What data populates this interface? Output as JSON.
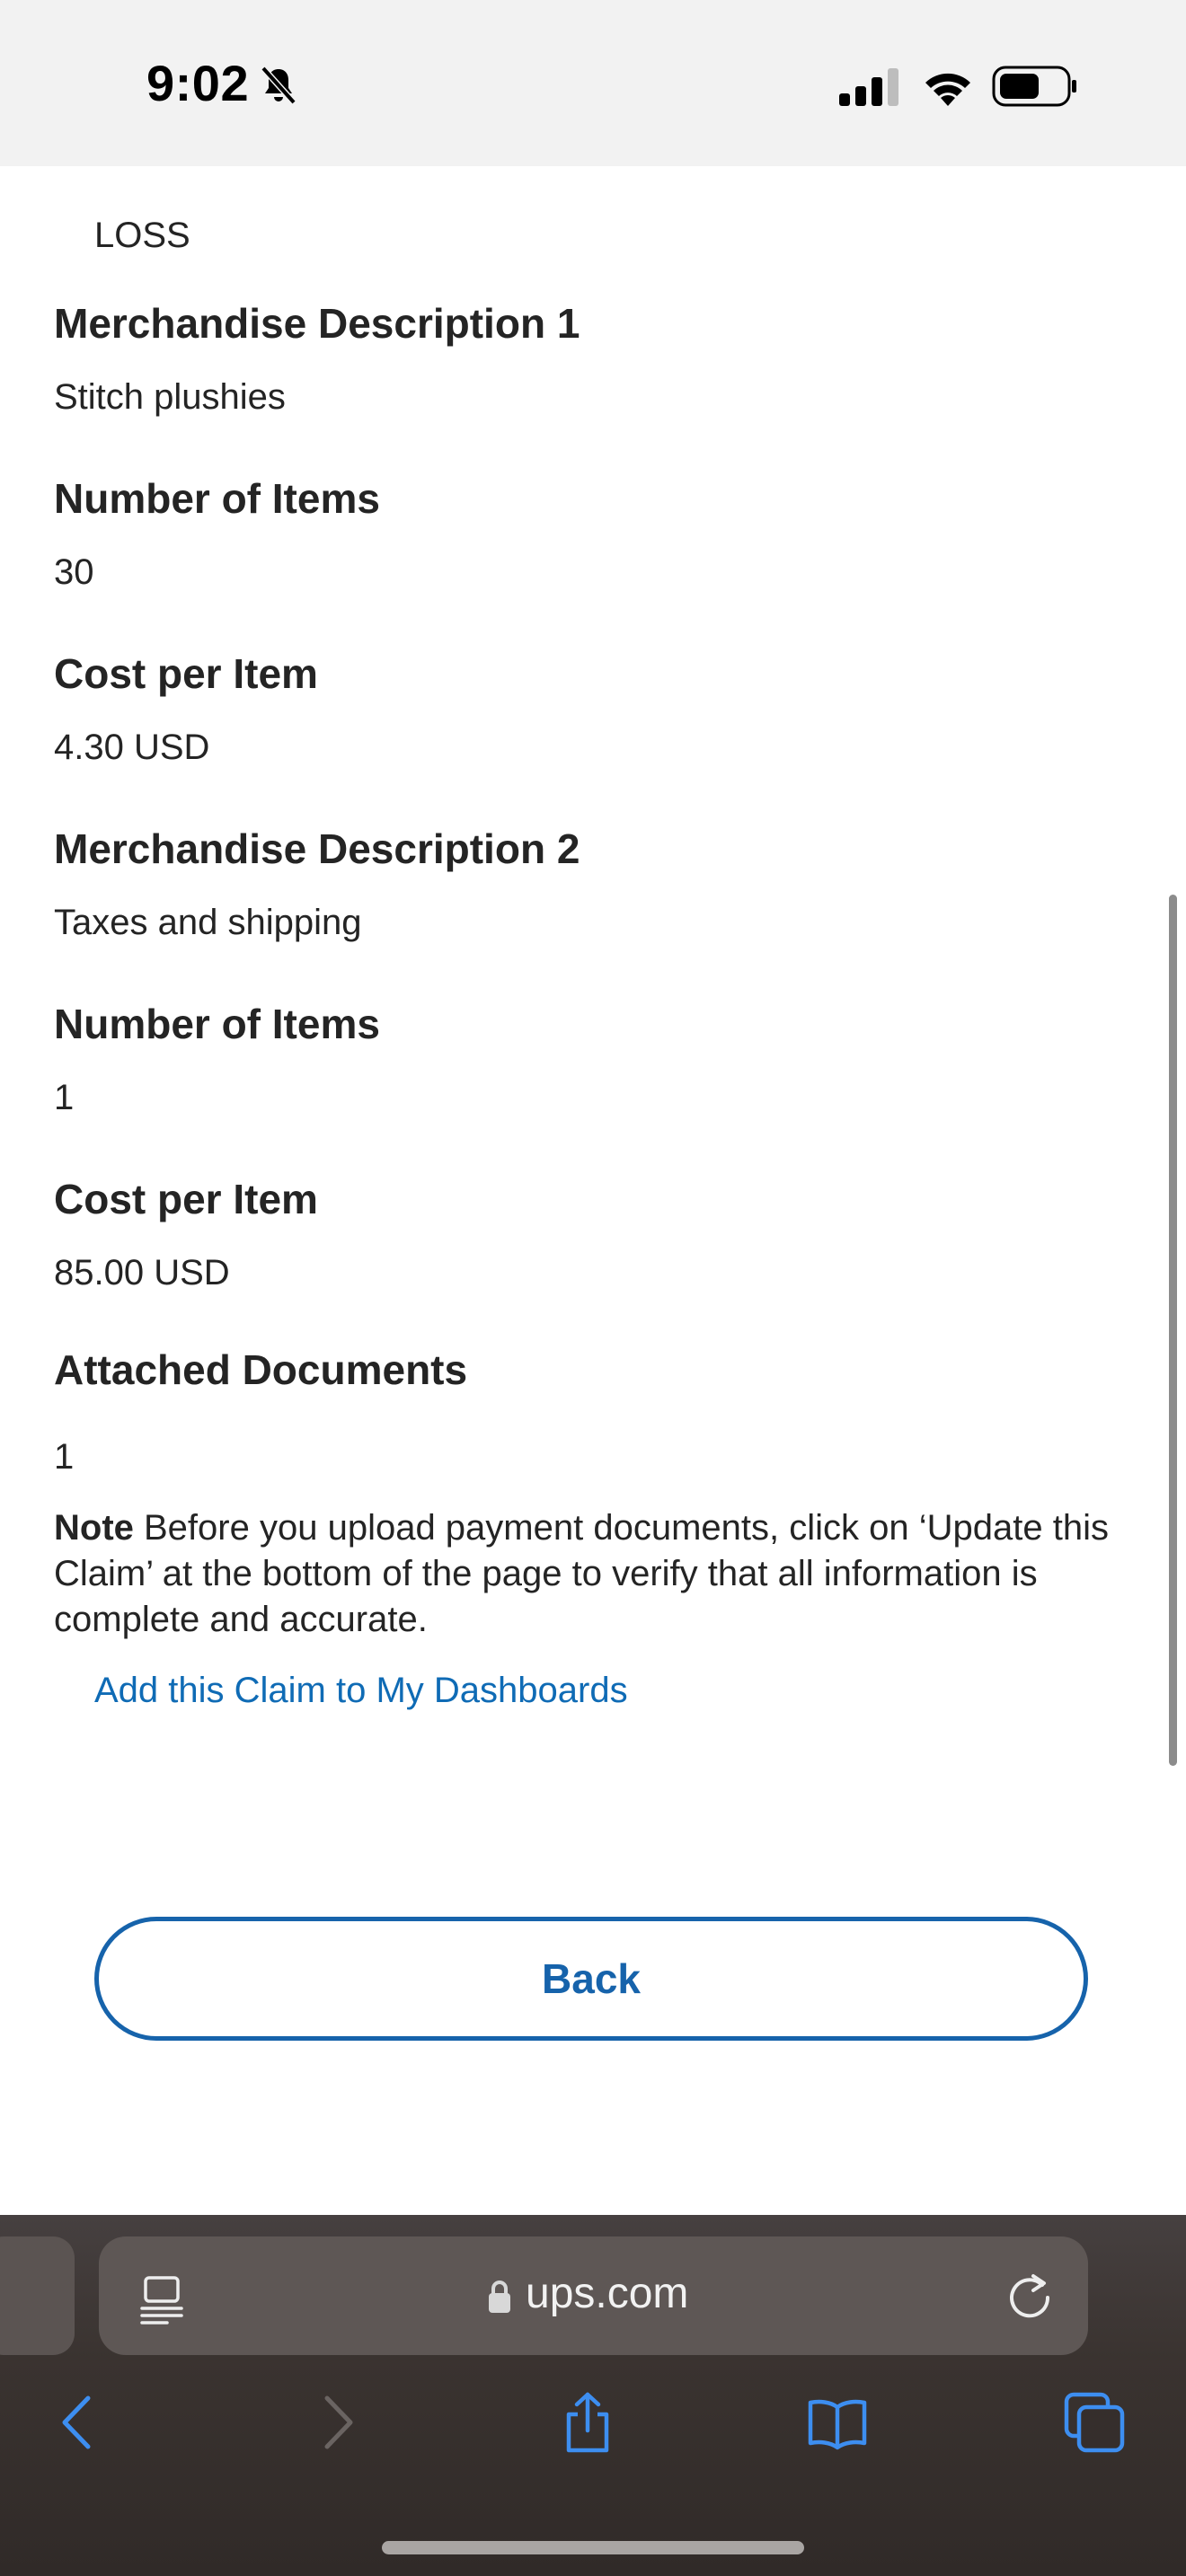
{
  "status_bar": {
    "time": "9:02",
    "icons": [
      "bell-off-icon",
      "signal-icon",
      "wifi-icon",
      "battery-icon"
    ]
  },
  "claim_details": {
    "loss_type_value": "LOSS",
    "merch_desc_1_label": "Merchandise Description 1",
    "merch_desc_1_value": "Stitch plushies",
    "items_1_label": "Number of Items",
    "items_1_value": "30",
    "cost_1_label": "Cost per Item",
    "cost_1_value": "4.30 USD",
    "merch_desc_2_label": "Merchandise Description 2",
    "merch_desc_2_value": "Taxes and shipping",
    "items_2_label": "Number of Items",
    "items_2_value": "1",
    "cost_2_label": "Cost per Item",
    "cost_2_value": "85.00 USD",
    "attached_label": "Attached Documents",
    "attached_value": "1"
  },
  "note": {
    "label": "Note",
    "text": " Before you upload payment documents, click on ‘Update this Claim’ at the bottom of the page to verify that all information is complete and accurate."
  },
  "dashboard_link": "Add this Claim to My Dashboards",
  "back_button": "Back",
  "browser": {
    "url": "ups.com"
  },
  "colors": {
    "link": "#0f6bb5",
    "button_border": "#1663ab",
    "toolbar_icon": "#3d8ef0"
  }
}
